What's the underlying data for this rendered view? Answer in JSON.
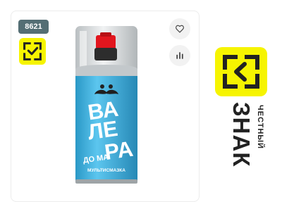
{
  "product_card": {
    "sku": "8621",
    "can": {
      "brand_line1": "ВА",
      "brand_line2": "ЛЕ",
      "brand_line3": "РА",
      "brand_small": "ДО МА",
      "subtitle": "МУЛЬТИСМАЗКА"
    }
  },
  "brand": {
    "line1": "ЧЕСТНЫЙ",
    "line2": "ЗНАК"
  },
  "icons": {
    "marking": "honest-sign-logo",
    "wishlist": "heart-icon",
    "compare": "bar-chart-icon"
  },
  "colors": {
    "badge_bg": "#546e74",
    "honest_sign_yellow": "#f6f400",
    "can_blue": "#3eb2e2",
    "cap_red": "#e2161e"
  }
}
